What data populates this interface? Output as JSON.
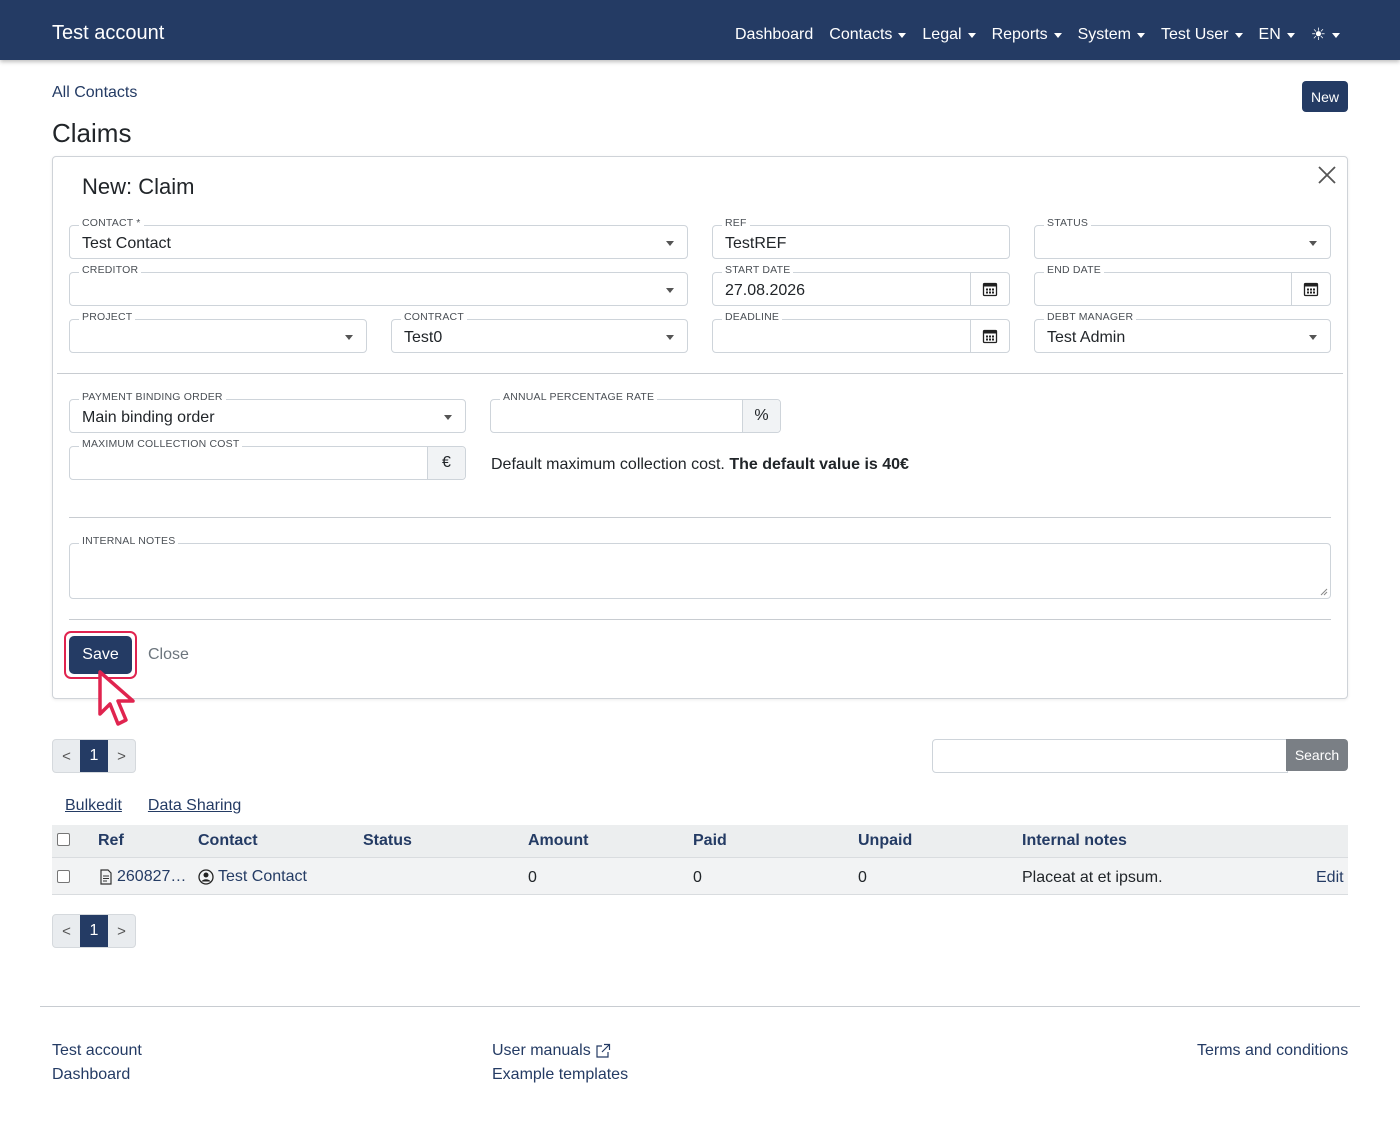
{
  "navbar": {
    "brand": "Test account",
    "items": [
      "Dashboard",
      "Contacts",
      "Legal",
      "Reports",
      "System",
      "Test User",
      "EN"
    ],
    "theme_icon": "☀"
  },
  "breadcrumb": "All Contacts",
  "new_button": "New",
  "page_title": "Claims",
  "form": {
    "title": "New: Claim",
    "contact": {
      "label": "CONTACT *",
      "value": "Test Contact"
    },
    "ref": {
      "label": "REF",
      "value": "TestREF"
    },
    "status": {
      "label": "STATUS",
      "value": ""
    },
    "creditor": {
      "label": "CREDITOR",
      "value": ""
    },
    "start_date": {
      "label": "START DATE",
      "value": "27.08.2026"
    },
    "end_date": {
      "label": "END DATE",
      "value": ""
    },
    "project": {
      "label": "PROJECT",
      "value": ""
    },
    "contract": {
      "label": "CONTRACT",
      "value": "Test0"
    },
    "deadline": {
      "label": "DEADLINE",
      "value": ""
    },
    "debt_manager": {
      "label": "DEBT MANAGER",
      "value": "Test Admin"
    },
    "payment_binding_order": {
      "label": "PAYMENT BINDING ORDER",
      "value": "Main binding order"
    },
    "annual_percentage_rate": {
      "label": "ANNUAL PERCENTAGE RATE",
      "value": "",
      "addon": "%"
    },
    "max_collection_cost": {
      "label": "MAXIMUM COLLECTION COST",
      "value": "",
      "addon": "€"
    },
    "help_text": "Default maximum collection cost.",
    "help_text_bold": "The default value is 40€",
    "internal_notes": {
      "label": "INTERNAL NOTES",
      "value": ""
    },
    "save_label": "Save",
    "close_label": "Close"
  },
  "pagination": {
    "prev": "<",
    "page": "1",
    "next": ">"
  },
  "search": {
    "placeholder": "",
    "button": "Search"
  },
  "links": {
    "bulkedit": "Bulkedit",
    "data_sharing": "Data Sharing"
  },
  "table": {
    "headers": [
      "Ref",
      "Contact",
      "Status",
      "Amount",
      "Paid",
      "Unpaid",
      "Internal notes"
    ],
    "rows": [
      {
        "ref": "260827…",
        "contact": "Test Contact",
        "status": "",
        "amount": "0",
        "paid": "0",
        "unpaid": "0",
        "notes": "Placeat at et ipsum.",
        "action": "Edit"
      }
    ]
  },
  "footer": {
    "col1": [
      "Test account",
      "Dashboard"
    ],
    "col2": [
      "User manuals",
      "Example templates"
    ],
    "col3": [
      "Terms and conditions"
    ]
  }
}
